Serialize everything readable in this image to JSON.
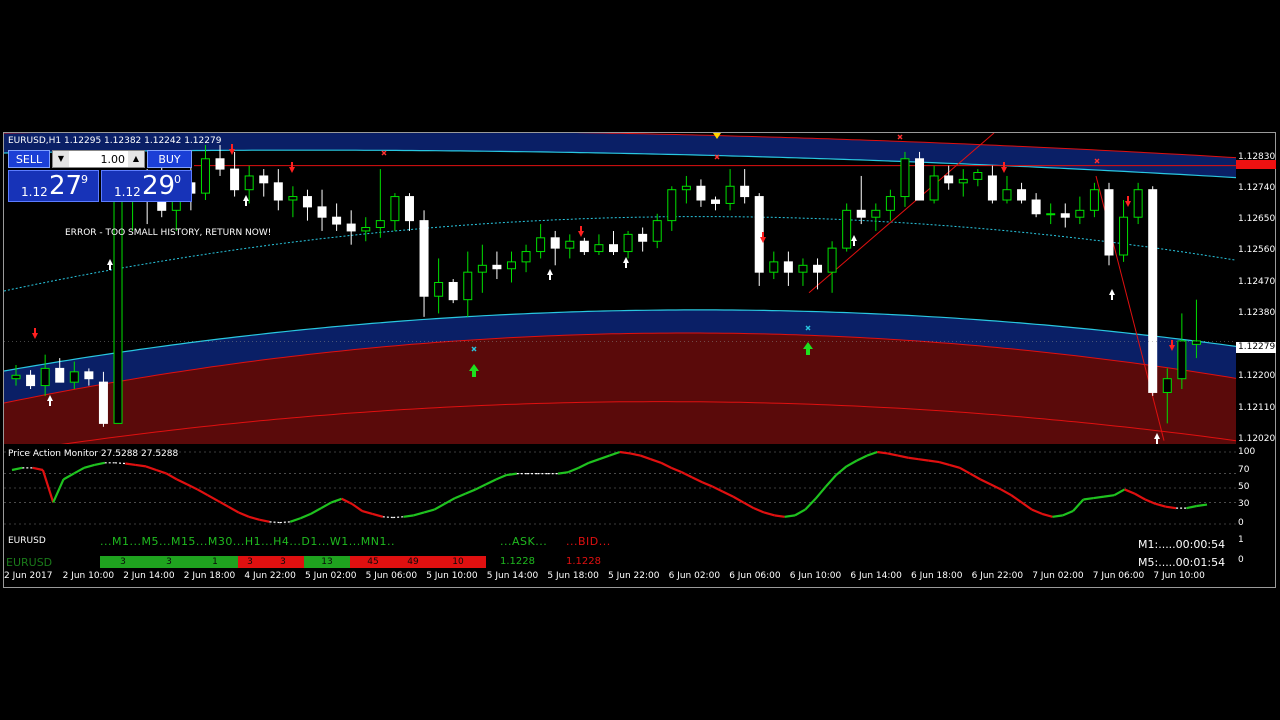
{
  "chart": {
    "title": "EURUSD,H1  1.12295 1.12382 1.12242 1.12279",
    "error": "ERROR - TOO SMALL HISTORY, RETURN NOW!",
    "symbol_small": "EURUSD",
    "symbol_green": "EURUSD",
    "colors": {
      "bull": "#00e000",
      "bear": "#ffffff",
      "band_blue": "#0a1f66",
      "band_red": "#5a0a0a",
      "cyan": "#29c7e0",
      "red": "#e01010"
    }
  },
  "trade_panel": {
    "sell_label": "SELL",
    "buy_label": "BUY",
    "lot_value": "1.00",
    "dec_icon": "▼",
    "inc_icon": "▲",
    "sell_prefix": "1.12",
    "sell_big": "27",
    "sell_sup": "9",
    "buy_prefix": "1.12",
    "buy_big": "29",
    "buy_sup": "0"
  },
  "price_axis": {
    "ticks": [
      "1.12830",
      "1.12740",
      "1.12650",
      "1.12560",
      "1.12470",
      "1.12380",
      "1.12200",
      "1.12110",
      "1.12020"
    ],
    "current": "1.12279"
  },
  "oscillator": {
    "title": "Price Action Monitor 27.5288 27.5288",
    "ticks": [
      "100",
      "70",
      "50",
      "30",
      "0"
    ]
  },
  "mtf_panel": {
    "timeframes": [
      "M1",
      "M5",
      "M15",
      "M30",
      "H1",
      "H4",
      "D1",
      "W1",
      "MN1"
    ],
    "tf_line": "...M1...M5...M15...M30...H1...H4...D1...W1...MN1..",
    "ask_label": "...ASK...",
    "bid_label": "...BID...",
    "cells": [
      "3",
      "3",
      "1",
      "3",
      "3",
      "13",
      "45",
      "49",
      "10"
    ],
    "cell_colors": [
      "#1fa31f",
      "#1fa31f",
      "#1fa31f",
      "#e01010",
      "#e01010",
      "#1fa31f",
      "#e01010",
      "#e01010",
      "#e01010"
    ],
    "ask_value": "1.1228",
    "bid_value": "1.1228",
    "axis_top": "1",
    "axis_bottom": "0"
  },
  "timers": {
    "m1": "M1:.....00:00:54",
    "m5": "M5:.....00:01:54"
  },
  "time_axis": [
    "2 Jun 2017",
    "2 Jun 10:00",
    "2 Jun 14:00",
    "2 Jun 18:00",
    "4 Jun 22:00",
    "5 Jun 02:00",
    "5 Jun 06:00",
    "5 Jun 10:00",
    "5 Jun 14:00",
    "5 Jun 18:00",
    "5 Jun 22:00",
    "6 Jun 02:00",
    "6 Jun 06:00",
    "6 Jun 10:00",
    "6 Jun 14:00",
    "6 Jun 18:00",
    "6 Jun 22:00",
    "7 Jun 02:00",
    "7 Jun 06:00",
    "7 Jun 10:00"
  ],
  "candles": [
    [
      1.1217,
      1.1221,
      1.1215,
      1.1218
    ],
    [
      1.1218,
      1.12195,
      1.1214,
      1.1215
    ],
    [
      1.1215,
      1.1224,
      1.1212,
      1.122
    ],
    [
      1.122,
      1.1223,
      1.1216,
      1.1216
    ],
    [
      1.1216,
      1.1222,
      1.1214,
      1.1219
    ],
    [
      1.1219,
      1.122,
      1.1215,
      1.1217
    ],
    [
      1.1216,
      1.1219,
      1.1203,
      1.1204
    ],
    [
      1.1204,
      1.127,
      1.1204,
      1.1269
    ],
    [
      1.1269,
      1.1276,
      1.126,
      1.1272
    ],
    [
      1.1272,
      1.1278,
      1.1262,
      1.127
    ],
    [
      1.127,
      1.1282,
      1.1264,
      1.1266
    ],
    [
      1.1266,
      1.1276,
      1.126,
      1.1274
    ],
    [
      1.1274,
      1.128,
      1.1266,
      1.1271
    ],
    [
      1.1271,
      1.1285,
      1.1269,
      1.1281
    ],
    [
      1.1281,
      1.1285,
      1.1276,
      1.1278
    ],
    [
      1.1278,
      1.1283,
      1.127,
      1.1272
    ],
    [
      1.1272,
      1.1279,
      1.1268,
      1.1276
    ],
    [
      1.1276,
      1.1278,
      1.127,
      1.1274
    ],
    [
      1.1274,
      1.1278,
      1.1266,
      1.1269
    ],
    [
      1.1269,
      1.1273,
      1.1264,
      1.127
    ],
    [
      1.127,
      1.1272,
      1.1263,
      1.1267
    ],
    [
      1.1267,
      1.1272,
      1.126,
      1.1264
    ],
    [
      1.1264,
      1.1268,
      1.126,
      1.1262
    ],
    [
      1.1262,
      1.1266,
      1.1256,
      1.126
    ],
    [
      1.126,
      1.1264,
      1.1257,
      1.1261
    ],
    [
      1.1261,
      1.1278,
      1.1258,
      1.1263
    ],
    [
      1.1263,
      1.1271,
      1.126,
      1.127
    ],
    [
      1.127,
      1.1271,
      1.126,
      1.1263
    ],
    [
      1.1263,
      1.1266,
      1.1235,
      1.1241
    ],
    [
      1.1241,
      1.1252,
      1.1236,
      1.1245
    ],
    [
      1.1245,
      1.1246,
      1.1239,
      1.124
    ],
    [
      1.124,
      1.1254,
      1.1235,
      1.1248
    ],
    [
      1.1248,
      1.1256,
      1.1242,
      1.125
    ],
    [
      1.125,
      1.1254,
      1.1246,
      1.1249
    ],
    [
      1.1249,
      1.1254,
      1.1245,
      1.1251
    ],
    [
      1.1251,
      1.1256,
      1.1248,
      1.1254
    ],
    [
      1.1254,
      1.1262,
      1.1252,
      1.1258
    ],
    [
      1.1258,
      1.126,
      1.125,
      1.1255
    ],
    [
      1.1255,
      1.1259,
      1.1252,
      1.1257
    ],
    [
      1.1257,
      1.1258,
      1.1253,
      1.1254
    ],
    [
      1.1254,
      1.1259,
      1.1253,
      1.1256
    ],
    [
      1.1256,
      1.126,
      1.1253,
      1.1254
    ],
    [
      1.1254,
      1.126,
      1.1252,
      1.1259
    ],
    [
      1.1259,
      1.1261,
      1.1254,
      1.1257
    ],
    [
      1.1257,
      1.1265,
      1.1255,
      1.1263
    ],
    [
      1.1263,
      1.1273,
      1.126,
      1.1272
    ],
    [
      1.1272,
      1.1276,
      1.1268,
      1.1273
    ],
    [
      1.1273,
      1.1275,
      1.1267,
      1.1269
    ],
    [
      1.1269,
      1.127,
      1.1266,
      1.1268
    ],
    [
      1.1268,
      1.1278,
      1.1266,
      1.1273
    ],
    [
      1.1273,
      1.1278,
      1.1268,
      1.127
    ],
    [
      1.127,
      1.1271,
      1.1244,
      1.1248
    ],
    [
      1.1248,
      1.1254,
      1.1246,
      1.1251
    ],
    [
      1.1251,
      1.1254,
      1.1244,
      1.1248
    ],
    [
      1.1248,
      1.1252,
      1.1244,
      1.125
    ],
    [
      1.125,
      1.1252,
      1.1243,
      1.1248
    ],
    [
      1.1248,
      1.1257,
      1.1242,
      1.1255
    ],
    [
      1.1255,
      1.1268,
      1.1254,
      1.1266
    ],
    [
      1.1266,
      1.1276,
      1.1262,
      1.1264
    ],
    [
      1.1264,
      1.1268,
      1.126,
      1.1266
    ],
    [
      1.1266,
      1.1272,
      1.1263,
      1.127
    ],
    [
      1.127,
      1.1283,
      1.1267,
      1.1281
    ],
    [
      1.1281,
      1.1283,
      1.1269,
      1.1269
    ],
    [
      1.1269,
      1.1279,
      1.1268,
      1.1276
    ],
    [
      1.1276,
      1.1279,
      1.1272,
      1.1274
    ],
    [
      1.1274,
      1.1278,
      1.127,
      1.1275
    ],
    [
      1.1275,
      1.1278,
      1.1273,
      1.1277
    ],
    [
      1.1276,
      1.1279,
      1.1268,
      1.1269
    ],
    [
      1.1269,
      1.1276,
      1.1268,
      1.1272
    ],
    [
      1.1272,
      1.1274,
      1.1268,
      1.1269
    ],
    [
      1.1269,
      1.1271,
      1.1264,
      1.1265
    ],
    [
      1.1265,
      1.1268,
      1.1262,
      1.1265
    ],
    [
      1.1265,
      1.1268,
      1.1261,
      1.1264
    ],
    [
      1.1264,
      1.127,
      1.1262,
      1.1266
    ],
    [
      1.1266,
      1.1274,
      1.1264,
      1.1272
    ],
    [
      1.1272,
      1.1274,
      1.125,
      1.1253
    ],
    [
      1.1253,
      1.1269,
      1.1251,
      1.1264
    ],
    [
      1.1264,
      1.1274,
      1.1262,
      1.1272
    ],
    [
      1.1272,
      1.1273,
      1.1212,
      1.1213
    ],
    [
      1.1213,
      1.122,
      1.1204,
      1.1217
    ],
    [
      1.1217,
      1.1236,
      1.1214,
      1.1228
    ],
    [
      1.1227,
      1.124,
      1.1223,
      1.1228
    ]
  ],
  "oscillator_values": [
    75,
    78,
    78,
    75,
    30,
    62,
    70,
    78,
    82,
    85,
    85,
    84,
    82,
    80,
    75,
    70,
    62,
    55,
    48,
    40,
    32,
    24,
    16,
    10,
    6,
    3,
    2,
    3,
    8,
    14,
    22,
    30,
    35,
    28,
    18,
    14,
    10,
    9,
    10,
    12,
    16,
    20,
    28,
    36,
    42,
    48,
    55,
    62,
    68,
    70,
    70,
    70,
    70,
    70,
    72,
    78,
    85,
    90,
    95,
    100,
    98,
    95,
    90,
    85,
    78,
    72,
    65,
    58,
    52,
    45,
    38,
    30,
    22,
    16,
    12,
    10,
    12,
    20,
    35,
    52,
    68,
    80,
    88,
    95,
    100,
    98,
    95,
    92,
    90,
    88,
    86,
    82,
    78,
    70,
    62,
    55,
    48,
    40,
    30,
    20,
    14,
    10,
    12,
    18,
    34,
    36,
    38,
    40,
    48,
    42,
    34,
    28,
    24,
    22,
    22,
    25,
    27
  ]
}
